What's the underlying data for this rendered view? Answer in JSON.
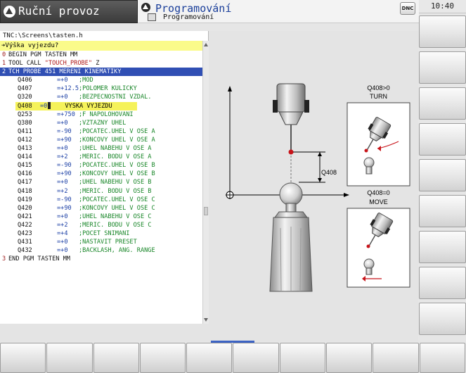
{
  "header": {
    "mode_label": "Ruční provoz",
    "prog_label": "Programování",
    "prog_sub": "Programování",
    "dnc_label": "DNC",
    "clock": "10:40"
  },
  "editor": {
    "path": "TNC:\\Screens\\tasten.h",
    "prompt": "➔Výška vyjezdu?",
    "lines": [
      {
        "n": "0",
        "text": "BEGIN PGM TASTEN MM"
      },
      {
        "n": "1",
        "text": "TOOL CALL ",
        "str": "\"TOUCH_PROBE\"",
        "tail": " Z"
      },
      {
        "n": "2",
        "text": "TCH PROBE 451 MERENI KINEMATIKY"
      },
      {
        "p": "Q406",
        "v": "=+0",
        "c": ";MOD"
      },
      {
        "p": "Q407",
        "v": "=+12.5",
        "c": ";POLOMER KULICKY"
      },
      {
        "p": "Q320",
        "v": "=+0",
        "c": ";BEZPECNOSTNI VZDAL."
      },
      {
        "p": "Q408",
        "v": "=0",
        "c": "VYSKA VYJEZDU"
      },
      {
        "p": "Q253",
        "v": "=+750",
        "c": ";F NAPOLOHOVANI"
      },
      {
        "p": "Q380",
        "v": "=+0",
        "c": ";VZTAZNY UHEL"
      },
      {
        "p": "Q411",
        "v": "=-90",
        "c": ";POCATEC.UHEL V OSE A"
      },
      {
        "p": "Q412",
        "v": "=+90",
        "c": ";KONCOVY UHEL V OSE A"
      },
      {
        "p": "Q413",
        "v": "=+0",
        "c": ";UHEL NABEHU V OSE A"
      },
      {
        "p": "Q414",
        "v": "=+2",
        "c": ";MERIC. BODU V OSE A"
      },
      {
        "p": "Q415",
        "v": "=-90",
        "c": ";POCATEC.UHEL V OSE B"
      },
      {
        "p": "Q416",
        "v": "=+90",
        "c": ";KONCOVY UHEL V OSE B"
      },
      {
        "p": "Q417",
        "v": "=+0",
        "c": ";UHEL NABEHU V OSE B"
      },
      {
        "p": "Q418",
        "v": "=+2",
        "c": ";MERIC. BODU V OSE B"
      },
      {
        "p": "Q419",
        "v": "=-90",
        "c": ";POCATEC.UHEL V OSE C"
      },
      {
        "p": "Q420",
        "v": "=+90",
        "c": ";KONCOVY UHEL V OSE C"
      },
      {
        "p": "Q421",
        "v": "=+0",
        "c": ";UHEL NABEHU V OSE C"
      },
      {
        "p": "Q422",
        "v": "=+2",
        "c": ";MERIC. BODU V OSE C"
      },
      {
        "p": "Q423",
        "v": "=+4",
        "c": ";POCET SNIMANI"
      },
      {
        "p": "Q431",
        "v": "=+0",
        "c": ";NASTAVIT PRESET"
      },
      {
        "p": "Q432",
        "v": "=+0",
        "c": ";BACKLASH, ANG. RANGE"
      },
      {
        "n": "3",
        "text": "END PGM TASTEN MM"
      }
    ]
  },
  "graphic": {
    "q408_label": "Q408",
    "turn_title": "Q408>0",
    "turn_label": "TURN",
    "move_title": "Q408=0",
    "move_label": "MOVE"
  },
  "colors": {
    "selection": "#304fb4",
    "prompt_bg": "#fafb8a",
    "comment": "#188628",
    "value": "#1b3fa5",
    "line_number": "#9b1a1a",
    "title_blue": "#1b3f9a"
  }
}
